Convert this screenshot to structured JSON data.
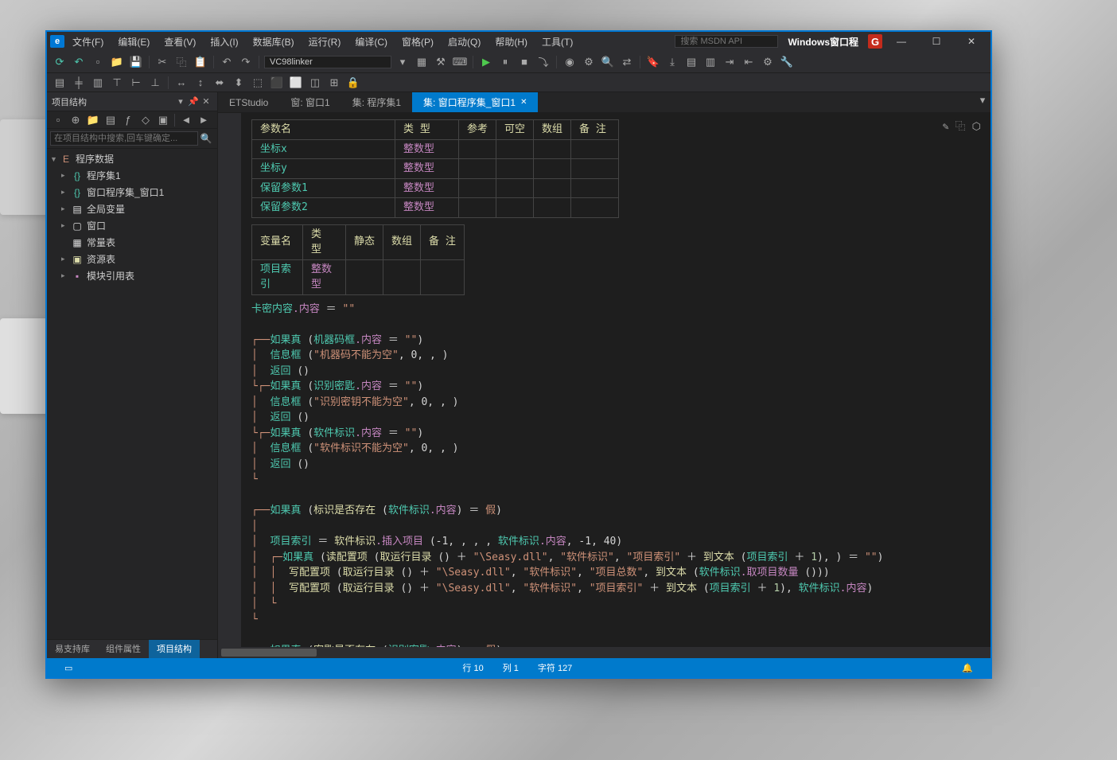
{
  "titlebar": {
    "logo": "e",
    "menus": [
      "文件(F)",
      "编辑(E)",
      "查看(V)",
      "插入(I)",
      "数据库(B)",
      "运行(R)",
      "编译(C)",
      "窗格(P)",
      "启动(Q)",
      "帮助(H)",
      "工具(T)"
    ],
    "search_placeholder": "搜索 MSDN API",
    "title": "Windows窗口程",
    "badge": "G"
  },
  "toolbar": {
    "dropdown": "VC98linker"
  },
  "sidebar": {
    "panel_title": "项目结构",
    "search_placeholder": "在项目结构中搜索,回车键确定...",
    "tree": [
      {
        "label": "程序数据",
        "icon": "app",
        "arrow": "▼",
        "lvl": 0
      },
      {
        "label": "程序集1",
        "icon": "braces",
        "arrow": "▸",
        "lvl": 1
      },
      {
        "label": "窗口程序集_窗口1",
        "icon": "braces",
        "arrow": "▸",
        "lvl": 1
      },
      {
        "label": "全局变量",
        "icon": "var",
        "arrow": "▸",
        "lvl": 1
      },
      {
        "label": "窗口",
        "icon": "window",
        "arrow": "▸",
        "lvl": 1
      },
      {
        "label": "常量表",
        "icon": "grid",
        "arrow": "",
        "lvl": 1
      },
      {
        "label": "资源表",
        "icon": "res",
        "arrow": "▸",
        "lvl": 1
      },
      {
        "label": "模块引用表",
        "icon": "mod",
        "arrow": "▸",
        "lvl": 1
      }
    ],
    "bottom_tabs": [
      "易支持库",
      "组件属性",
      "项目结构"
    ],
    "active_btab": 2
  },
  "editor": {
    "tabs": [
      "ETStudio",
      "窗: 窗口1",
      "集: 程序集1",
      "集: 窗口程序集_窗口1"
    ],
    "active_tab": 3,
    "param_headers": [
      "参数名",
      "类  型",
      "参考",
      "可空",
      "数组",
      "备  注"
    ],
    "params": [
      {
        "name": "坐标x",
        "type": "整数型"
      },
      {
        "name": "坐标y",
        "type": "整数型"
      },
      {
        "name": "保留参数1",
        "type": "整数型"
      },
      {
        "name": "保留参数2",
        "type": "整数型"
      }
    ],
    "var_headers": [
      "变量名",
      "类  型",
      "静态",
      "数组",
      "备  注"
    ],
    "vars": [
      {
        "name": "项目索引",
        "type": "整数型"
      }
    ],
    "code": {
      "line0": {
        "a": "卡密内容",
        "b": ".内容",
        "c": " ＝ ",
        "d": "\"\""
      },
      "if1": {
        "kw": "如果真",
        "arg1": "机器码框",
        "prop": ".内容",
        "op": " ＝ ",
        "str": "\"\""
      },
      "msg1": {
        "fn": "信息框",
        "str": "\"机器码不能为空\"",
        "args": ", 0, , "
      },
      "ret": {
        "kw": "返回"
      },
      "if2": {
        "kw": "如果真",
        "arg1": "识别密匙",
        "prop": ".内容",
        "op": " ＝ ",
        "str": "\"\""
      },
      "msg2": {
        "fn": "信息框",
        "str": "\"识别密钥不能为空\"",
        "args": ", 0, , "
      },
      "if3": {
        "kw": "如果真",
        "arg1": "软件标识",
        "prop": ".内容",
        "op": " ＝ ",
        "str": "\"\""
      },
      "msg3": {
        "fn": "信息框",
        "str": "\"软件标识不能为空\"",
        "args": ", 0, , "
      },
      "if4": {
        "kw": "如果真",
        "fn": "标识是否存在",
        "arg1": "软件标识",
        "prop": ".内容",
        "op": "＝ ",
        "val": "假"
      },
      "assign": {
        "var": "项目索引",
        "op": " ＝ ",
        "obj": "软件标识",
        "method": ".插入项目",
        "args_a": " (-1, , , , ",
        "args_b": "软件标识",
        "args_c": ".内容",
        "args_d": ", -1, 40)"
      },
      "if5": {
        "kw": "如果真",
        "fn": "读配置项",
        "run": "取运行目录",
        "dll": "\"\\Seasy.dll\"",
        "s1": "\"软件标识\"",
        "s2": "\"项目索引\"",
        "tx": "到文本",
        "var": "项目索引",
        "n": "1",
        "empty": "\"\""
      },
      "w1": {
        "fn": "写配置项",
        "run": "取运行目录",
        "dll": "\"\\Seasy.dll\"",
        "s1": "\"软件标识\"",
        "s2": "\"项目总数\"",
        "tx": "到文本",
        "obj": "软件标识",
        "m": ".取项目数量"
      },
      "w2": {
        "fn": "写配置项",
        "run": "取运行目录",
        "dll": "\"\\Seasy.dll\"",
        "s1": "\"软件标识\"",
        "s2": "\"项目索引\"",
        "tx": "到文本",
        "var": "项目索引",
        "n": "1",
        "obj": "软件标识",
        "prop": ".内容"
      },
      "if6": {
        "kw": "如果真",
        "fn": "密匙是否存在",
        "arg1": "识别密匙",
        "prop": ".内容",
        "op": "＝ ",
        "val": "假"
      }
    }
  },
  "statusbar": {
    "line": "行 10",
    "col": "列 1",
    "chars": "字符 127"
  }
}
